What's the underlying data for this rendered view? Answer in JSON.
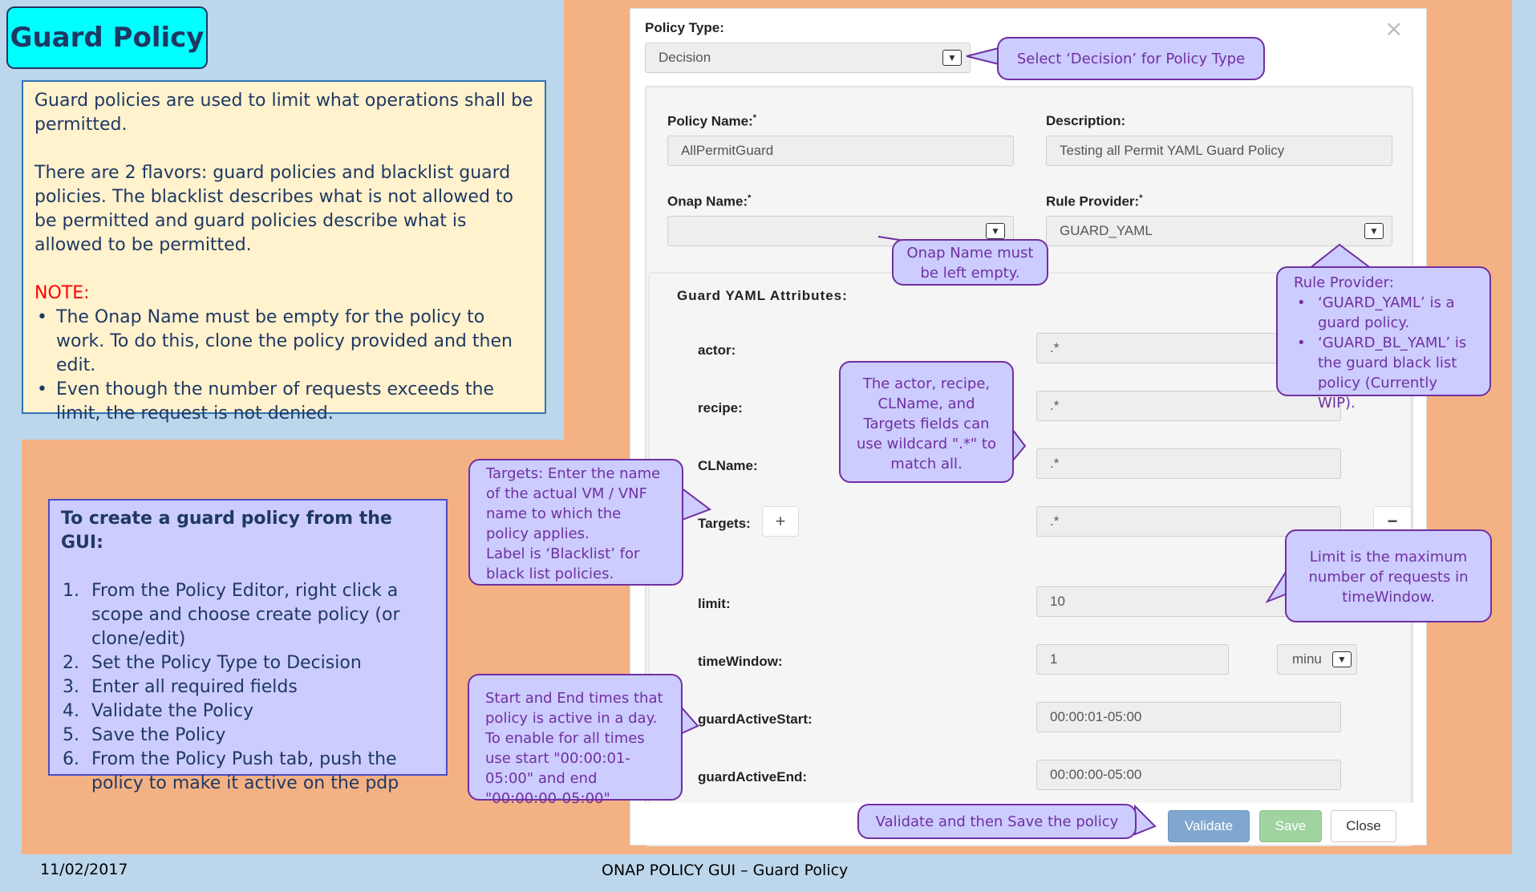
{
  "slide": {
    "title": "Guard Policy",
    "info": {
      "p1": "Guard policies are used to limit what operations shall be permitted.",
      "p2": "There are 2 flavors: guard policies and blacklist guard policies. The blacklist describes what is not allowed to be permitted and  guard policies describe what is allowed to be permitted.",
      "note_label": "NOTE:",
      "bullets": [
        "The Onap Name must be empty for the policy to work.  To do this, clone the policy provided and then edit.",
        "Even though the number of requests exceeds the limit, the request is not denied."
      ]
    },
    "steps": {
      "heading": "To create a guard policy from the GUI:",
      "items": [
        {
          "n": "1.",
          "text": "From the Policy Editor, right click a scope and choose create policy (or clone/edit)"
        },
        {
          "n": "2.",
          "text": "Set the Policy Type to Decision"
        },
        {
          "n": "3.",
          "text": "Enter all required fields"
        },
        {
          "n": "4.",
          "text": "Validate the Policy"
        },
        {
          "n": "5.",
          "text": "Save the Policy"
        },
        {
          "n": "6.",
          "text": "From the Policy Push tab, push the policy to make it active on the pdp"
        }
      ]
    },
    "footer": {
      "date": "11/02/2017",
      "center": "ONAP  POLICY  GUI – Guard Policy"
    }
  },
  "dialog": {
    "close_glyph": "×",
    "policy_type": {
      "label": "Policy Type:",
      "value": "Decision"
    },
    "policy_name": {
      "label": "Policy Name:",
      "req": "*",
      "value": "AllPermitGuard"
    },
    "description": {
      "label": "Description:",
      "value": "Testing all Permit YAML Guard Policy"
    },
    "onap_name": {
      "label": "Onap Name:",
      "req": "*",
      "value": ""
    },
    "rule_provider": {
      "label": "Rule Provider:",
      "req": "*",
      "value": "GUARD_YAML"
    },
    "attributes": {
      "heading": "Guard YAML Attributes:",
      "actor": {
        "label": "actor:",
        "value": ".*"
      },
      "recipe": {
        "label": "recipe:",
        "value": ".*"
      },
      "clname": {
        "label": "CLName:",
        "value": ".*"
      },
      "targets": {
        "label": "Targets:",
        "value": ".*",
        "add": "+",
        "remove": "−"
      },
      "limit": {
        "label": "limit:",
        "value": "10"
      },
      "time_window": {
        "label": "timeWindow:",
        "value": "1",
        "unit": "minu"
      },
      "active_start": {
        "label": "guardActiveStart:",
        "value": "00:00:01-05:00"
      },
      "active_end": {
        "label": "guardActiveEnd:",
        "value": "00:00:00-05:00"
      }
    },
    "buttons": {
      "validate": "Validate",
      "save": "Save",
      "close": "Close"
    }
  },
  "callouts": {
    "policy_type": "Select ‘Decision’ for Policy Type",
    "onap_name": "Onap Name must be left empty.",
    "rule_provider_title": "Rule Provider:",
    "rule_provider_b1": "‘GUARD_YAML’ is a guard policy.",
    "rule_provider_b2": "‘GUARD_BL_YAML’ is the guard black list policy (Currently WIP).",
    "wildcard": "The actor, recipe, CLName, and Targets  fields can use wildcard \".*\" to match all.",
    "targets": "Targets: Enter the name of the actual VM / VNF name to which the policy applies.\nLabel is ‘Blacklist’ for black list policies.",
    "limit": "Limit is the maximum number of requests in timeWindow.",
    "times": "Start and End times that policy is active in a day.\nTo enable for all times use start \"00:00:01-05:00\" and end \"00:00:00-05:00\"",
    "validate": "Validate and then Save the policy"
  },
  "colors": {
    "background": "#bcd7ec",
    "orange": "#f4b183",
    "callout_fill": "#ccccff",
    "callout_text": "#7030a0",
    "validate_btn": "#7fa7cf",
    "save_btn": "#9fd39f"
  }
}
